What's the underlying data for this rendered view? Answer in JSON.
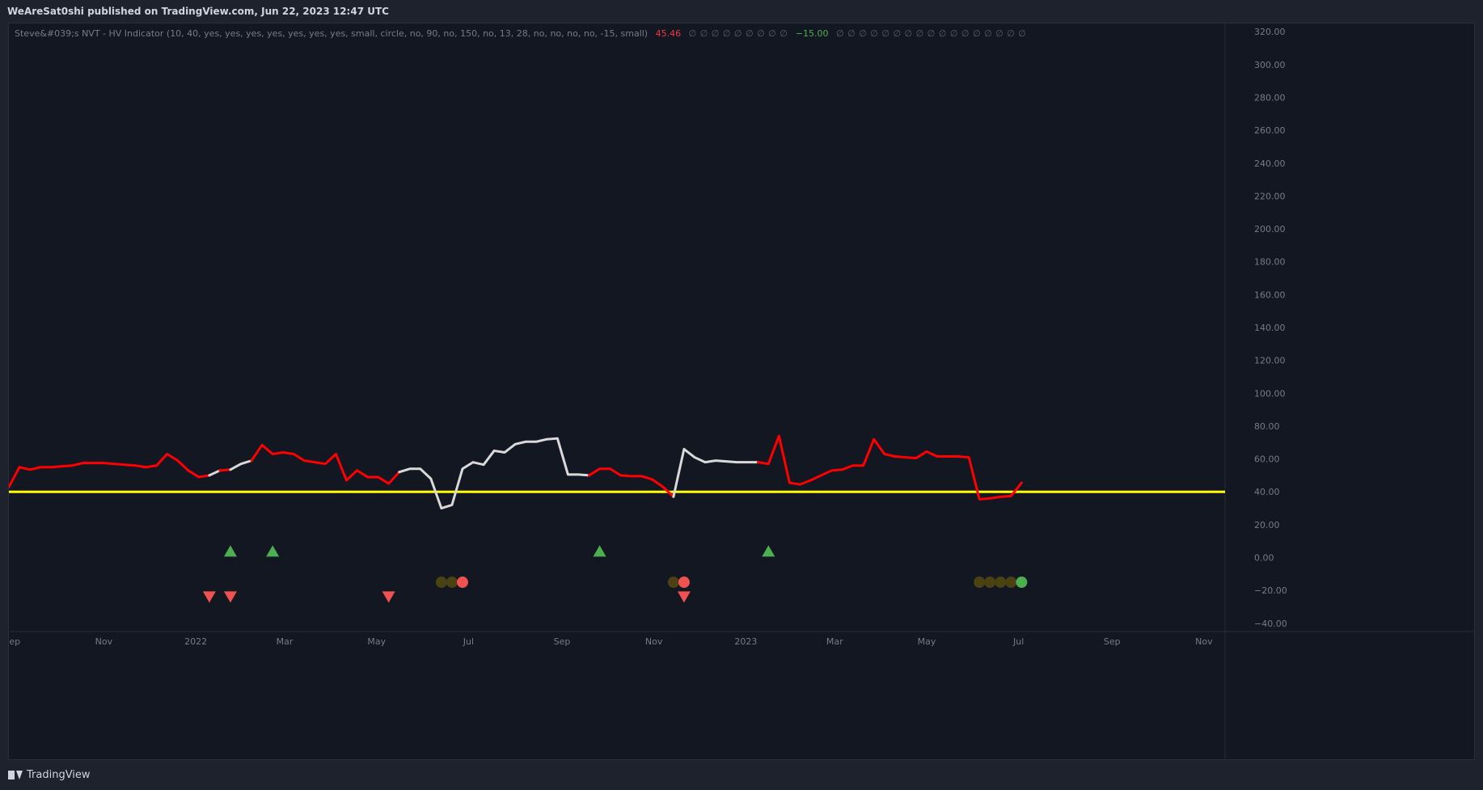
{
  "header": {
    "published": "WeAreSat0shi published on TradingView.com, Jun 22, 2023 12:47 UTC"
  },
  "legend": {
    "title": "Steve&#039;s NVT - HV Indicator (10, 40, yes, yes, yes, yes, yes, yes, yes, small, circle, no, 90, no, 150, no, 13, 28, no, no, no, no, -15, small)",
    "value_red": "45.46",
    "zeros_a": "∅ ∅ ∅ ∅ ∅ ∅ ∅ ∅ ∅",
    "value_green": "−15.00",
    "zeros_b": "∅ ∅ ∅ ∅ ∅ ∅ ∅ ∅ ∅ ∅ ∅ ∅ ∅ ∅ ∅ ∅ ∅"
  },
  "footer": {
    "brand": "TradingView"
  },
  "colors": {
    "bg": "#131722",
    "line_red": "#ff0000",
    "line_white": "#d9d9d9",
    "threshold": "#ffff00",
    "up_marker": "#4caf50",
    "down_marker": "#f05252",
    "dim_marker": "#4a4213",
    "axis_text": "#787b86"
  },
  "chart_data": {
    "type": "line",
    "y_axis": {
      "min": -40,
      "max": 320,
      "range": [
        -45,
        325
      ],
      "ticks": [
        "320.00",
        "300.00",
        "280.00",
        "260.00",
        "240.00",
        "220.00",
        "200.00",
        "180.00",
        "160.00",
        "140.00",
        "120.00",
        "100.00",
        "80.00",
        "60.00",
        "40.00",
        "20.00",
        "0.00",
        "−20.00",
        "−40.00"
      ],
      "tick_values": [
        320,
        300,
        280,
        260,
        240,
        220,
        200,
        180,
        160,
        140,
        120,
        100,
        80,
        60,
        40,
        20,
        0,
        -20,
        -40
      ]
    },
    "x_axis": {
      "range": [
        "2021-08-30",
        "2023-11-15"
      ],
      "ticks": [
        {
          "label": "Sep",
          "date": "2021-09-01"
        },
        {
          "label": "Nov",
          "date": "2021-11-01"
        },
        {
          "label": "2022",
          "date": "2022-01-01"
        },
        {
          "label": "Mar",
          "date": "2022-03-01"
        },
        {
          "label": "May",
          "date": "2022-05-01"
        },
        {
          "label": "Jul",
          "date": "2022-07-01"
        },
        {
          "label": "Sep",
          "date": "2022-09-01"
        },
        {
          "label": "Nov",
          "date": "2022-11-01"
        },
        {
          "label": "2023",
          "date": "2023-01-01"
        },
        {
          "label": "Mar",
          "date": "2023-03-01"
        },
        {
          "label": "May",
          "date": "2023-05-01"
        },
        {
          "label": "Jul",
          "date": "2023-07-01"
        },
        {
          "label": "Sep",
          "date": "2023-09-01"
        },
        {
          "label": "Nov",
          "date": "2023-11-01"
        }
      ]
    },
    "threshold": 40,
    "series": [
      {
        "points": [
          [
            "2021-08-30",
            43
          ],
          [
            "2021-09-06",
            55
          ],
          [
            "2021-09-13",
            53.5
          ],
          [
            "2021-09-20",
            55
          ],
          [
            "2021-09-27",
            55
          ],
          [
            "2021-10-04",
            55.5
          ],
          [
            "2021-10-11",
            56
          ],
          [
            "2021-10-18",
            57.5
          ],
          [
            "2021-10-25",
            57.5
          ],
          [
            "2021-11-01",
            57.5
          ],
          [
            "2021-11-08",
            57
          ],
          [
            "2021-11-15",
            56.5
          ],
          [
            "2021-11-22",
            56
          ],
          [
            "2021-11-29",
            55
          ],
          [
            "2021-12-06",
            56
          ],
          [
            "2021-12-13",
            63
          ],
          [
            "2021-12-20",
            59
          ],
          [
            "2021-12-27",
            53
          ],
          [
            "2022-01-03",
            49
          ],
          [
            "2022-01-10",
            50
          ],
          [
            "2022-01-17",
            53
          ],
          [
            "2022-01-24",
            53.5
          ],
          [
            "2022-01-31",
            57
          ],
          [
            "2022-02-07",
            59
          ],
          [
            "2022-02-14",
            68.5
          ],
          [
            "2022-02-21",
            63
          ],
          [
            "2022-02-28",
            64
          ],
          [
            "2022-03-07",
            63
          ],
          [
            "2022-03-14",
            59
          ],
          [
            "2022-03-21",
            58
          ],
          [
            "2022-03-28",
            57
          ],
          [
            "2022-04-04",
            63
          ],
          [
            "2022-04-11",
            47
          ],
          [
            "2022-04-18",
            53
          ],
          [
            "2022-04-25",
            49
          ],
          [
            "2022-05-02",
            49
          ],
          [
            "2022-05-09",
            45
          ],
          [
            "2022-05-16",
            52
          ],
          [
            "2022-05-23",
            54
          ],
          [
            "2022-05-30",
            54
          ],
          [
            "2022-06-06",
            48
          ],
          [
            "2022-06-13",
            30
          ],
          [
            "2022-06-20",
            32
          ],
          [
            "2022-06-27",
            54
          ],
          [
            "2022-07-04",
            58
          ],
          [
            "2022-07-11",
            56.5
          ],
          [
            "2022-07-18",
            65
          ],
          [
            "2022-07-25",
            64
          ],
          [
            "2022-08-01",
            69
          ],
          [
            "2022-08-08",
            70.5
          ],
          [
            "2022-08-15",
            70.5
          ],
          [
            "2022-08-22",
            72
          ],
          [
            "2022-08-29",
            72.5
          ],
          [
            "2022-09-05",
            50.5
          ],
          [
            "2022-09-12",
            50.5
          ],
          [
            "2022-09-19",
            50
          ],
          [
            "2022-09-26",
            54
          ],
          [
            "2022-10-03",
            54
          ],
          [
            "2022-10-10",
            50
          ],
          [
            "2022-10-17",
            49.5
          ],
          [
            "2022-10-24",
            49.5
          ],
          [
            "2022-10-31",
            47.5
          ],
          [
            "2022-11-07",
            43
          ],
          [
            "2022-11-14",
            37
          ],
          [
            "2022-11-21",
            66
          ],
          [
            "2022-11-28",
            61
          ],
          [
            "2022-12-05",
            58
          ],
          [
            "2022-12-12",
            59
          ],
          [
            "2022-12-19",
            58.5
          ],
          [
            "2022-12-26",
            58
          ],
          [
            "2023-01-02",
            58
          ],
          [
            "2023-01-09",
            58
          ],
          [
            "2023-01-16",
            57
          ],
          [
            "2023-01-23",
            74
          ],
          [
            "2023-01-30",
            45.5
          ],
          [
            "2023-02-06",
            44.5
          ],
          [
            "2023-02-13",
            47
          ],
          [
            "2023-02-20",
            50
          ],
          [
            "2023-02-27",
            53
          ],
          [
            "2023-03-06",
            53.5
          ],
          [
            "2023-03-13",
            56
          ],
          [
            "2023-03-20",
            56
          ],
          [
            "2023-03-27",
            72
          ],
          [
            "2023-04-03",
            63
          ],
          [
            "2023-04-10",
            61.5
          ],
          [
            "2023-04-17",
            61
          ],
          [
            "2023-04-24",
            60.5
          ],
          [
            "2023-05-01",
            64.5
          ],
          [
            "2023-05-08",
            61.5
          ],
          [
            "2023-05-15",
            61.5
          ],
          [
            "2023-05-22",
            61.5
          ],
          [
            "2023-05-29",
            61
          ],
          [
            "2023-06-05",
            35.5
          ],
          [
            "2023-06-12",
            36
          ],
          [
            "2023-06-19",
            37
          ],
          [
            "2023-06-26",
            37.5
          ],
          [
            "2023-07-03",
            45.5
          ]
        ],
        "white_ranges": [
          [
            "2022-01-10",
            "2022-01-17"
          ],
          [
            "2022-01-24",
            "2022-02-07"
          ],
          [
            "2022-05-16",
            "2022-09-19"
          ],
          [
            "2022-11-14",
            "2023-01-09"
          ]
        ]
      }
    ],
    "markers": [
      {
        "shape": "triangle-up",
        "date": "2022-01-24",
        "y": 4,
        "color": "up"
      },
      {
        "shape": "triangle-up",
        "date": "2022-02-21",
        "y": 4,
        "color": "up"
      },
      {
        "shape": "triangle-up",
        "date": "2022-09-26",
        "y": 4,
        "color": "up"
      },
      {
        "shape": "triangle-up",
        "date": "2023-01-16",
        "y": 4,
        "color": "up"
      },
      {
        "shape": "triangle-down",
        "date": "2022-01-10",
        "y": -24,
        "color": "down"
      },
      {
        "shape": "triangle-down",
        "date": "2022-01-24",
        "y": -24,
        "color": "down"
      },
      {
        "shape": "triangle-down",
        "date": "2022-05-09",
        "y": -24,
        "color": "down"
      },
      {
        "shape": "triangle-down",
        "date": "2022-11-21",
        "y": -24,
        "color": "down"
      },
      {
        "shape": "circle",
        "date": "2022-06-13",
        "y": -15,
        "color": "dim"
      },
      {
        "shape": "circle",
        "date": "2022-06-20",
        "y": -15,
        "color": "dim"
      },
      {
        "shape": "circle",
        "date": "2022-06-27",
        "y": -15,
        "color": "down"
      },
      {
        "shape": "circle",
        "date": "2022-11-14",
        "y": -15,
        "color": "dim"
      },
      {
        "shape": "circle",
        "date": "2022-11-21",
        "y": -15,
        "color": "down"
      },
      {
        "shape": "circle",
        "date": "2023-06-05",
        "y": -15,
        "color": "dim"
      },
      {
        "shape": "circle",
        "date": "2023-06-12",
        "y": -15,
        "color": "dim"
      },
      {
        "shape": "circle",
        "date": "2023-06-19",
        "y": -15,
        "color": "dim"
      },
      {
        "shape": "circle",
        "date": "2023-06-26",
        "y": -15,
        "color": "dim"
      },
      {
        "shape": "circle",
        "date": "2023-07-03",
        "y": -15,
        "color": "up"
      }
    ]
  }
}
